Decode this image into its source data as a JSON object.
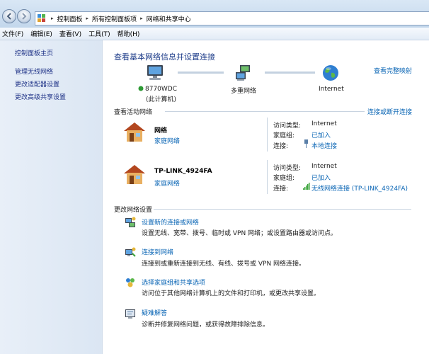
{
  "address_bar": {
    "crumbs": [
      "控制面板",
      "所有控制面板项",
      "网络和共享中心"
    ]
  },
  "menu": {
    "items": [
      "文件(F)",
      "编辑(E)",
      "查看(V)",
      "工具(T)",
      "帮助(H)"
    ]
  },
  "sidebar": {
    "home": "控制面板主页",
    "links": [
      "管理无线网络",
      "更改适配器设置",
      "更改高级共享设置"
    ]
  },
  "main": {
    "title": "查看基本网络信息并设置连接",
    "full_map_link": "查看完整映射",
    "map": {
      "computer_name": "8770WDC",
      "computer_sub": "(此计算机)",
      "middle": "多重网络",
      "internet": "Internet"
    },
    "active_networks_label": "查看活动网络",
    "connect_disconnect_link": "连接或断开连接",
    "networks": [
      {
        "name": "网络",
        "type": "家庭网络",
        "access_label": "访问类型:",
        "access_value": "Internet",
        "homegroup_label": "家庭组:",
        "homegroup_value": "已加入",
        "connection_label": "连接:",
        "connection_value": "本地连接"
      },
      {
        "name": "TP-LINK_4924FA",
        "type": "家庭网络",
        "access_label": "访问类型:",
        "access_value": "Internet",
        "homegroup_label": "家庭组:",
        "homegroup_value": "已加入",
        "connection_label": "连接:",
        "connection_value": "无线网络连接 (TP-LINK_4924FA)"
      }
    ],
    "change_settings_label": "更改网络设置",
    "tasks": [
      {
        "link": "设置新的连接或网络",
        "desc": "设置无线、宽带、拨号、临时或 VPN 网络；或设置路由器或访问点。"
      },
      {
        "link": "连接到网络",
        "desc": "连接到或重新连接到无线、有线、拨号或 VPN 网络连接。"
      },
      {
        "link": "选择家庭组和共享选项",
        "desc": "访问位于其他网络计算机上的文件和打印机，或更改共享设置。"
      },
      {
        "link": "疑难解答",
        "desc": "诊断并修复网络问题，或获得故障排除信息。"
      }
    ]
  }
}
